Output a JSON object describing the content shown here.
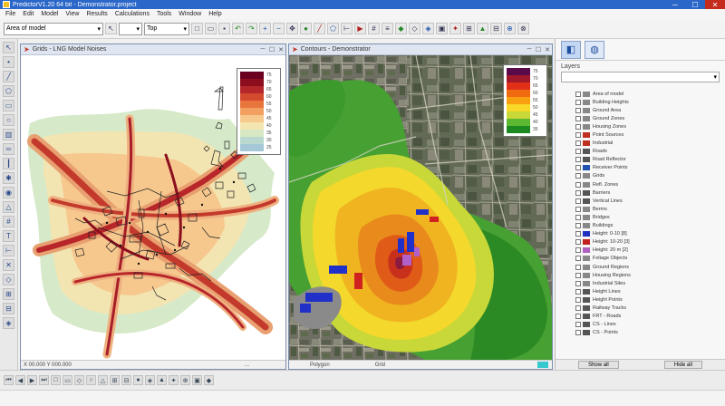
{
  "titlebar": {
    "title": "PredictorV1.20 64 bit - Demonstrator.project",
    "min": "─",
    "max": "☐",
    "close": "✕"
  },
  "menu": [
    "File",
    "Edit",
    "Model",
    "View",
    "Results",
    "Calculations",
    "Tools",
    "Window",
    "Help"
  ],
  "toolbar": {
    "layer_select": "Area of model",
    "view_select": "Top",
    "zoom_select": ""
  },
  "left_window": {
    "title": "Grids - LNG Model Noises",
    "status_left": "X 00.000   Y 000.000",
    "status_right": "..."
  },
  "right_window": {
    "title": "Contours - Demonstrator",
    "status_left": "Polygon",
    "status_mid": "Grid"
  },
  "left_legend": [
    {
      "label": "75",
      "color": "#6a0020"
    },
    {
      "label": "70",
      "color": "#8c0e1e"
    },
    {
      "label": "65",
      "color": "#b4262a"
    },
    {
      "label": "60",
      "color": "#d44a2e"
    },
    {
      "label": "55",
      "color": "#e8763c"
    },
    {
      "label": "50",
      "color": "#f2a062"
    },
    {
      "label": "45",
      "color": "#f7c98c"
    },
    {
      "label": "40",
      "color": "#f4e6b0"
    },
    {
      "label": "35",
      "color": "#d8e8c4"
    },
    {
      "label": "30",
      "color": "#b8d8d0"
    },
    {
      "label": "25",
      "color": "#a4c8d8"
    }
  ],
  "right_legend": [
    {
      "label": "75",
      "color": "#5a0a4a"
    },
    {
      "label": "70",
      "color": "#a0182a"
    },
    {
      "label": "65",
      "color": "#e03018"
    },
    {
      "label": "60",
      "color": "#f06a10"
    },
    {
      "label": "55",
      "color": "#f8a010"
    },
    {
      "label": "50",
      "color": "#f8d828"
    },
    {
      "label": "45",
      "color": "#c8d838"
    },
    {
      "label": "40",
      "color": "#5cb830"
    },
    {
      "label": "35",
      "color": "#1c8a20"
    }
  ],
  "right_panel": {
    "caption": "Layers",
    "tree": [
      {
        "label": "Area of model",
        "checked": true,
        "icon": "#888888"
      },
      {
        "label": "Building Heights",
        "checked": true,
        "icon": "#888888"
      },
      {
        "label": "Ground Area",
        "checked": true,
        "icon": "#888888"
      },
      {
        "label": "Ground Zones",
        "checked": true,
        "icon": "#888888"
      },
      {
        "label": "Housing Zones",
        "checked": true,
        "icon": "#888888"
      },
      {
        "label": "Point Sources",
        "checked": true,
        "icon": "#c03020"
      },
      {
        "label": "Industrial",
        "checked": true,
        "icon": "#c03020"
      },
      {
        "label": "Roads",
        "checked": true,
        "icon": "#555555"
      },
      {
        "label": "Road Reflector",
        "checked": true,
        "icon": "#555555"
      },
      {
        "label": "Receiver Points",
        "checked": true,
        "icon": "#2050b0"
      },
      {
        "label": "Grids",
        "checked": true,
        "icon": "#888888"
      },
      {
        "label": "Refl. Zones",
        "checked": true,
        "icon": "#888888"
      },
      {
        "label": "Barriers",
        "checked": true,
        "icon": "#555555"
      },
      {
        "label": "Vertical Lines",
        "checked": true,
        "icon": "#555555"
      },
      {
        "label": "Berms",
        "checked": true,
        "icon": "#888888"
      },
      {
        "label": "Bridges",
        "checked": false,
        "icon": "#888888"
      },
      {
        "label": "Buildings",
        "checked": true,
        "icon": "#888888"
      },
      {
        "label": "Height: 0-10  [8]",
        "checked": true,
        "icon": "#2030c0"
      },
      {
        "label": "Height: 10-20  [3]",
        "checked": true,
        "icon": "#c02020"
      },
      {
        "label": "Height: 20 m  [2]",
        "checked": true,
        "icon": "#b060c0"
      },
      {
        "label": "Foliage Objects",
        "checked": true,
        "icon": "#888888"
      },
      {
        "label": "Ground Regions",
        "checked": true,
        "icon": "#888888"
      },
      {
        "label": "Housing Regions",
        "checked": true,
        "icon": "#888888"
      },
      {
        "label": "Industrial Sites",
        "checked": true,
        "icon": "#888888"
      },
      {
        "label": "Height Lines",
        "checked": true,
        "icon": "#555555"
      },
      {
        "label": "Height Points",
        "checked": true,
        "icon": "#555555"
      },
      {
        "label": "Railway Tracks",
        "checked": true,
        "icon": "#555555"
      },
      {
        "label": "FRT - Roads",
        "checked": true,
        "icon": "#555555"
      },
      {
        "label": "CS - Lines",
        "checked": true,
        "icon": "#555555"
      },
      {
        "label": "CS - Points",
        "checked": true,
        "icon": "#555555"
      }
    ],
    "btn_left": "Show all",
    "btn_right": "Hide all"
  }
}
